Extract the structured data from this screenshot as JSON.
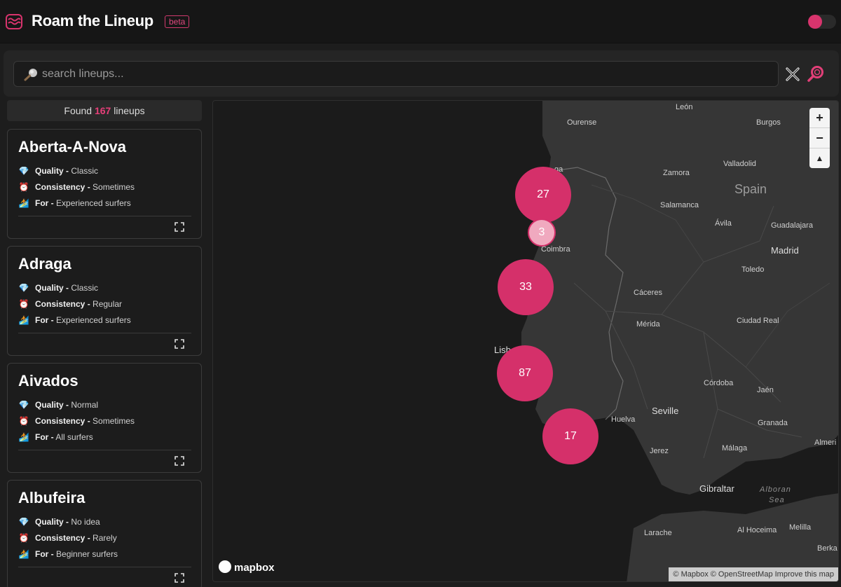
{
  "header": {
    "logo_icon": "waves-icon",
    "title": "Roam the Lineup",
    "badge": "beta",
    "toggle_state": "on",
    "accent_color": "#d8346d"
  },
  "search": {
    "placeholder": "search lineups...",
    "value": "",
    "clear_icon": "close-x-icon",
    "submit_icon": "magnifier-icon"
  },
  "results": {
    "prefix": "Found",
    "count": "167",
    "suffix": "lineups"
  },
  "cards": [
    {
      "name": "Aberta-A-Nova",
      "quality_label": "Quality -",
      "quality": "Classic",
      "consistency_label": "Consistency -",
      "consistency": "Sometimes",
      "for_label": "For -",
      "for": "Experienced surfers"
    },
    {
      "name": "Adraga",
      "quality_label": "Quality -",
      "quality": "Classic",
      "consistency_label": "Consistency -",
      "consistency": "Regular",
      "for_label": "For -",
      "for": "Experienced surfers"
    },
    {
      "name": "Aivados",
      "quality_label": "Quality -",
      "quality": "Normal",
      "consistency_label": "Consistency -",
      "consistency": "Sometimes",
      "for_label": "For -",
      "for": "All surfers"
    },
    {
      "name": "Albufeira",
      "quality_label": "Quality -",
      "quality": "No idea",
      "consistency_label": "Consistency -",
      "consistency": "Rarely",
      "for_label": "For -",
      "for": "Beginner surfers"
    }
  ],
  "map": {
    "clusters": [
      "27",
      "3",
      "33",
      "87",
      "17"
    ],
    "places": {
      "leon": "León",
      "ourense": "Ourense",
      "burgos": "Burgos",
      "zamora": "Zamora",
      "valladolid": "Valladolid",
      "spain": "Spain",
      "salamanca": "Salamanca",
      "avila": "Ávila",
      "guadalajara": "Guadalajara",
      "coimbra": "Coimbra",
      "madrid": "Madrid",
      "toledo": "Toledo",
      "caceres": "Cáceres",
      "merida": "Mérida",
      "ciudad_real": "Ciudad Real",
      "lisbon": "Lisb",
      "cordoba": "Córdoba",
      "jaen": "Jaén",
      "sevilla": "Seville",
      "huelva": "Huelva",
      "granada": "Granada",
      "almeria": "Almeri",
      "jerez": "Jerez",
      "malaga": "Málaga",
      "gibraltar": "Gibraltar",
      "alboran": "Alboran",
      "sea": "Sea",
      "larache": "Larache",
      "al_hoceima": "Al Hoceima",
      "melilla": "Melilla",
      "berkane": "Berka",
      "vigo": "ga"
    },
    "zoom_in": "+",
    "zoom_out": "−",
    "compass": "▲",
    "logo": "mapbox",
    "attribution": "© Mapbox © OpenStreetMap Improve this map"
  }
}
